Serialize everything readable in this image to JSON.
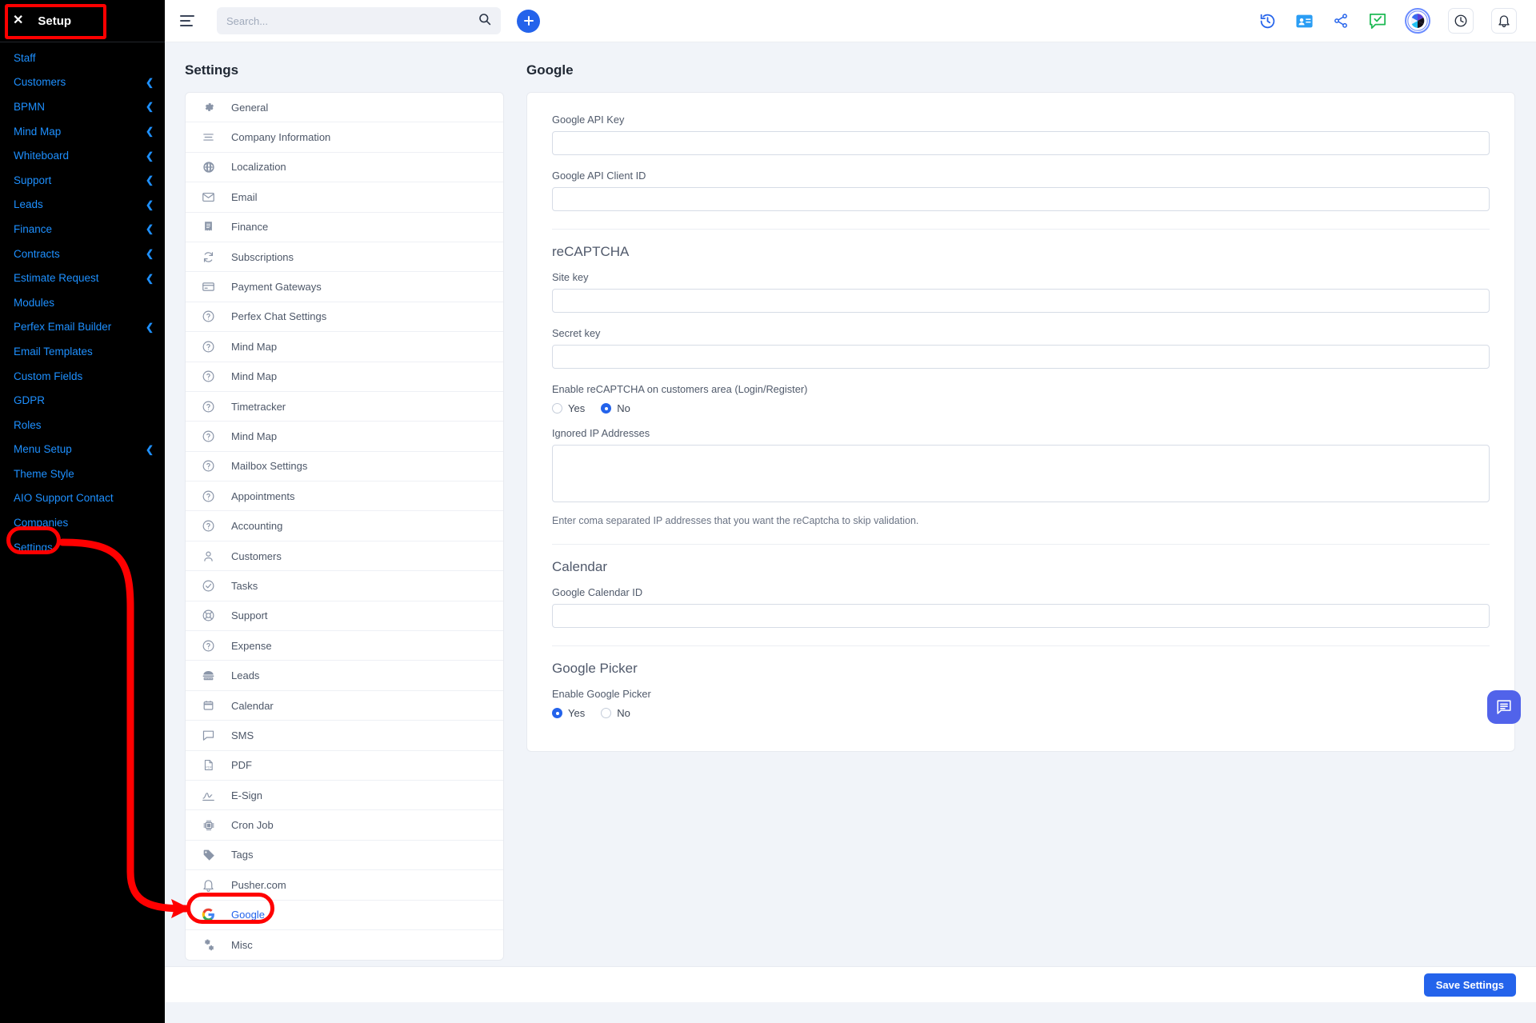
{
  "sidebar": {
    "close_icon": "close-icon",
    "title": "Setup",
    "items": [
      {
        "label": "Staff",
        "chevron": false
      },
      {
        "label": "Customers",
        "chevron": true
      },
      {
        "label": "BPMN",
        "chevron": true
      },
      {
        "label": "Mind Map",
        "chevron": true
      },
      {
        "label": "Whiteboard",
        "chevron": true
      },
      {
        "label": "Support",
        "chevron": true
      },
      {
        "label": "Leads",
        "chevron": true
      },
      {
        "label": "Finance",
        "chevron": true
      },
      {
        "label": "Contracts",
        "chevron": true
      },
      {
        "label": "Estimate Request",
        "chevron": true
      },
      {
        "label": "Modules",
        "chevron": false
      },
      {
        "label": "Perfex Email Builder",
        "chevron": true
      },
      {
        "label": "Email Templates",
        "chevron": false
      },
      {
        "label": "Custom Fields",
        "chevron": false
      },
      {
        "label": "GDPR",
        "chevron": false
      },
      {
        "label": "Roles",
        "chevron": false
      },
      {
        "label": "Menu Setup",
        "chevron": true
      },
      {
        "label": "Theme Style",
        "chevron": false
      },
      {
        "label": "AIO Support Contact",
        "chevron": false
      },
      {
        "label": "Companies",
        "chevron": false
      },
      {
        "label": "Settings",
        "chevron": false
      }
    ],
    "chevron_glyph": "❮"
  },
  "topbar": {
    "menu_icon": "hamburger-menu-icon",
    "search_placeholder": "Search...",
    "search_value": "",
    "search_icon": "search-icon",
    "add_button_label": "+",
    "icons": [
      "history-icon",
      "contact-card-icon",
      "share-icon",
      "feedback-icon",
      "user-avatar",
      "clock-icon",
      "bell-icon"
    ]
  },
  "settings_panel": {
    "title": "Settings",
    "items": [
      {
        "label": "General",
        "icon": "gear-icon"
      },
      {
        "label": "Company Information",
        "icon": "lines-icon"
      },
      {
        "label": "Localization",
        "icon": "globe-icon"
      },
      {
        "label": "Email",
        "icon": "envelope-icon"
      },
      {
        "label": "Finance",
        "icon": "receipt-icon"
      },
      {
        "label": "Subscriptions",
        "icon": "refresh-icon"
      },
      {
        "label": "Payment Gateways",
        "icon": "credit-card-icon"
      },
      {
        "label": "Perfex Chat Settings",
        "icon": "question-circle-icon"
      },
      {
        "label": "Mind Map",
        "icon": "question-circle-icon"
      },
      {
        "label": "Mind Map",
        "icon": "question-circle-icon"
      },
      {
        "label": "Timetracker",
        "icon": "question-circle-icon"
      },
      {
        "label": "Mind Map",
        "icon": "question-circle-icon"
      },
      {
        "label": "Mailbox Settings",
        "icon": "question-circle-icon"
      },
      {
        "label": "Appointments",
        "icon": "question-circle-icon"
      },
      {
        "label": "Accounting",
        "icon": "question-circle-icon"
      },
      {
        "label": "Customers",
        "icon": "user-icon"
      },
      {
        "label": "Tasks",
        "icon": "check-circle-icon"
      },
      {
        "label": "Support",
        "icon": "lifebuoy-icon"
      },
      {
        "label": "Expense",
        "icon": "question-circle-icon"
      },
      {
        "label": "Leads",
        "icon": "phone-icon"
      },
      {
        "label": "Calendar",
        "icon": "calendar-icon"
      },
      {
        "label": "SMS",
        "icon": "chat-icon"
      },
      {
        "label": "PDF",
        "icon": "pdf-icon"
      },
      {
        "label": "E-Sign",
        "icon": "signature-icon"
      },
      {
        "label": "Cron Job",
        "icon": "chip-icon"
      },
      {
        "label": "Tags",
        "icon": "tag-icon"
      },
      {
        "label": "Pusher.com",
        "icon": "bell-icon"
      },
      {
        "label": "Google",
        "icon": "google-icon",
        "active": true
      },
      {
        "label": "Misc",
        "icon": "gears-icon"
      }
    ]
  },
  "google_panel": {
    "title": "Google",
    "api_key_label": "Google API Key",
    "api_key_value": "",
    "client_id_label": "Google API Client ID",
    "client_id_value": "",
    "recaptcha_title": "reCAPTCHA",
    "site_key_label": "Site key",
    "site_key_value": "",
    "secret_key_label": "Secret key",
    "secret_key_value": "",
    "enable_recaptcha_label": "Enable reCAPTCHA on customers area (Login/Register)",
    "enable_recaptcha_yes": "Yes",
    "enable_recaptcha_no": "No",
    "enable_recaptcha_selected": "No",
    "ignored_ip_label": "Ignored IP Addresses",
    "ignored_ip_value": "",
    "ignored_ip_help": "Enter coma separated IP addresses that you want the reCaptcha to skip validation.",
    "calendar_title": "Calendar",
    "calendar_id_label": "Google Calendar ID",
    "calendar_id_value": "",
    "picker_title": "Google Picker",
    "picker_label": "Enable Google Picker",
    "picker_yes": "Yes",
    "picker_no": "No",
    "picker_selected": "Yes"
  },
  "footer": {
    "save_label": "Save Settings"
  },
  "chat_fab": {
    "icon": "chat-bubble-icon"
  },
  "colors": {
    "accent": "#2463eb",
    "sidebar_bg": "#000000",
    "sidebar_link": "#1e90ff",
    "annotation": "#ff0000",
    "page_bg": "#f1f4f9"
  }
}
